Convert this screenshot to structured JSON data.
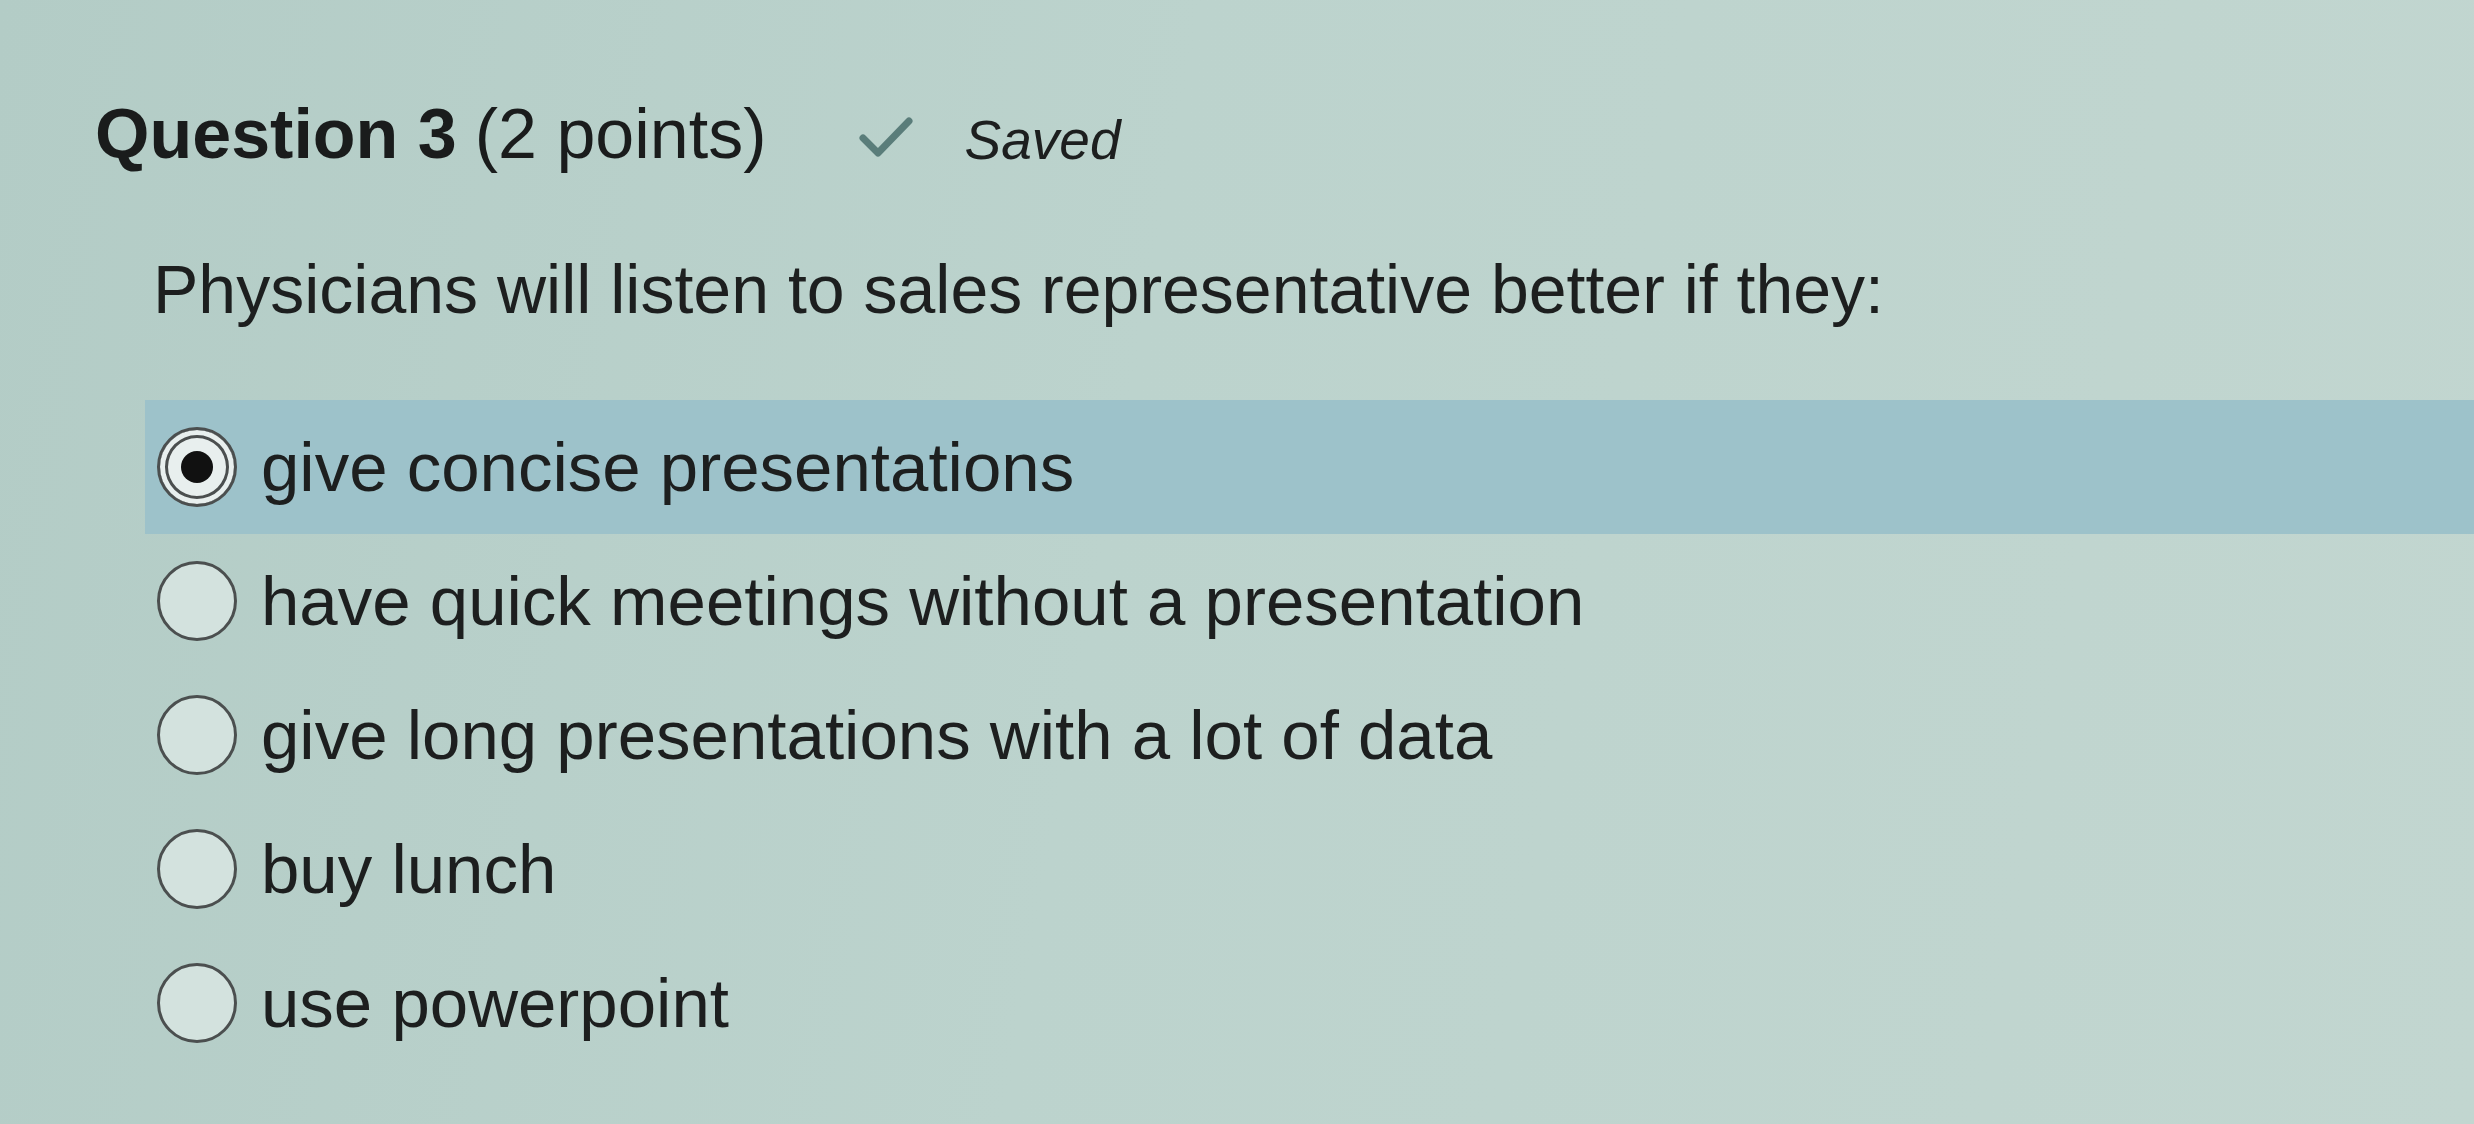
{
  "question": {
    "title": "Question 3",
    "points": "(2 points)",
    "status": {
      "kind": "saved",
      "label": "Saved"
    },
    "prompt": "Physicians will listen to sales representative better if they:"
  },
  "options": [
    {
      "label": "give concise presentations",
      "selected": true
    },
    {
      "label": "have quick meetings without a presentation",
      "selected": false
    },
    {
      "label": "give long presentations with a lot of data",
      "selected": false
    },
    {
      "label": "buy lunch",
      "selected": false
    },
    {
      "label": "use powerpoint",
      "selected": false
    }
  ]
}
